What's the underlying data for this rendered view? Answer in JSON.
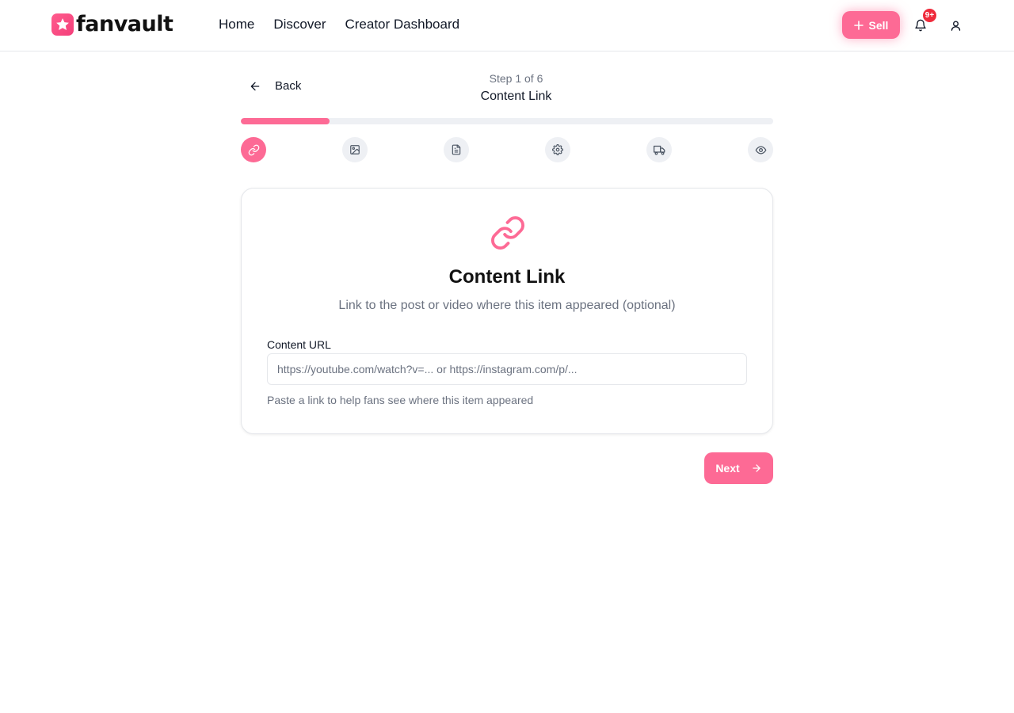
{
  "brand": {
    "name": "fanvault",
    "logo_icon": "star-icon",
    "accent": "#fd6a95"
  },
  "nav": {
    "items": [
      {
        "label": "Home"
      },
      {
        "label": "Discover"
      },
      {
        "label": "Creator Dashboard"
      }
    ]
  },
  "header": {
    "sell_label": "Sell",
    "notification_count": "9+"
  },
  "wizard": {
    "back_label": "Back",
    "step_counter": "Step 1 of 6",
    "step_title": "Content Link",
    "progress_fraction": 0.1667,
    "steps": [
      {
        "icon": "link-icon",
        "active": true
      },
      {
        "icon": "image-icon",
        "active": false
      },
      {
        "icon": "document-icon",
        "active": false
      },
      {
        "icon": "gear-icon",
        "active": false
      },
      {
        "icon": "truck-icon",
        "active": false
      },
      {
        "icon": "eye-icon",
        "active": false
      }
    ]
  },
  "card": {
    "icon": "link-icon",
    "title": "Content Link",
    "subtitle": "Link to the post or video where this item appeared (optional)",
    "field_label": "Content URL",
    "field_value": "",
    "field_placeholder": "https://youtube.com/watch?v=... or https://instagram.com/p/...",
    "field_help": "Paste a link to help fans see where this item appeared"
  },
  "footer": {
    "next_label": "Next"
  }
}
